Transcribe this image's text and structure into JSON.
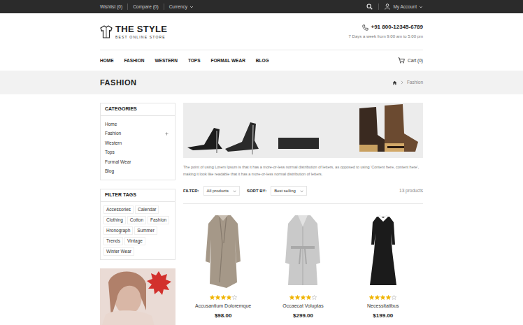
{
  "topbar": {
    "links": [
      {
        "label": "Wishlist (0)",
        "dropdown": false
      },
      {
        "label": "Compare (0)",
        "dropdown": false
      },
      {
        "label": "Currency",
        "dropdown": true
      }
    ],
    "account": "My Account"
  },
  "logo": {
    "title": "THE STYLE",
    "tagline": "BEST ONLINE STORE"
  },
  "contact": {
    "phone": "+91 800-12345-6789",
    "hours": "7 Days a week from 9:00 am to 5:00 pm"
  },
  "nav": [
    "HOME",
    "FASHION",
    "WESTERN",
    "TOPS",
    "FORMAL WEAR",
    "BLOG"
  ],
  "cart": "Cart (0)",
  "page_title": "FASHION",
  "breadcrumb": [
    "Fashion"
  ],
  "sidebar": {
    "categories": {
      "title": "CATEGORIES",
      "items": [
        {
          "label": "Home",
          "expandable": false
        },
        {
          "label": "Fashion",
          "expandable": true
        },
        {
          "label": "Western",
          "expandable": false
        },
        {
          "label": "Tops",
          "expandable": false
        },
        {
          "label": "Formal Wear",
          "expandable": false
        },
        {
          "label": "Blog",
          "expandable": false
        }
      ]
    },
    "tags": {
      "title": "FILTER TAGS",
      "items": [
        "Accessories",
        "Calendar",
        "Clothing",
        "Cotton",
        "Fashion",
        "Hronograph",
        "Summer",
        "Trends",
        "Vintage",
        "Winter Wear"
      ]
    }
  },
  "description": "The point of using Lorem Ipsum is that it has a more-or-less normal distribution of letters, as opposed to using 'Content here, content here', making it look like readable that it has a more-or-less normal distribution of letters.",
  "toolbar": {
    "filter_label": "FILTER:",
    "filter_value": "All products",
    "sort_label": "SORT BY:",
    "sort_value": "Best selling",
    "count": "13 products"
  },
  "products": [
    {
      "name": "Accusantium Doloremque",
      "price": "$98.00",
      "stars": 4,
      "kind": "coat"
    },
    {
      "name": "Occaecat Voluptas",
      "price": "$299.00",
      "stars": 4,
      "kind": "robe"
    },
    {
      "name": "Necessitatibus",
      "price": "$199.00",
      "stars": 4,
      "kind": "dress"
    }
  ]
}
